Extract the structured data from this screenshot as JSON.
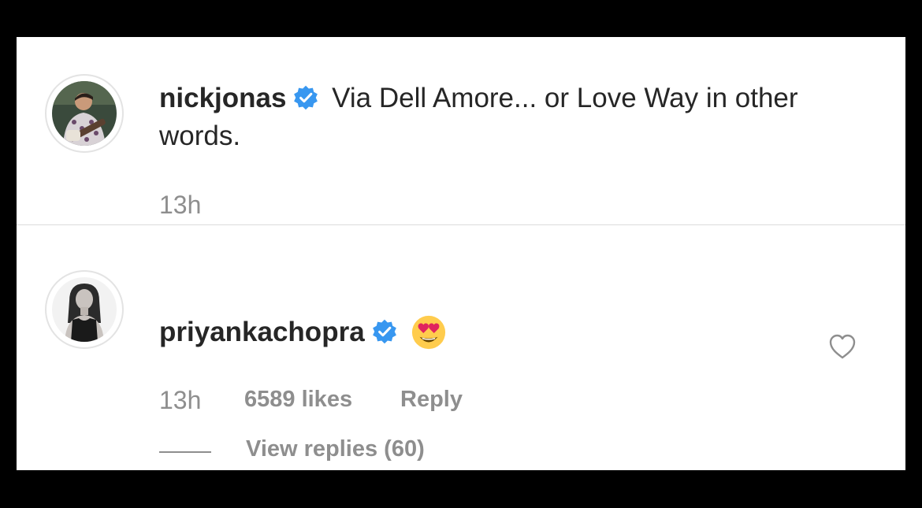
{
  "comments": [
    {
      "username": "nickjonas",
      "verified": true,
      "text": "Via Dell Amore... or Love Way in other words.",
      "time": "13h",
      "avatar": "guitarist-avatar"
    },
    {
      "username": "priyankachopra",
      "verified": true,
      "emoji": "heart-eyes-emoji",
      "time": "13h",
      "likes": "6589 likes",
      "reply_label": "Reply",
      "view_replies": "View replies (60)",
      "avatar": "portrait-avatar"
    }
  ],
  "colors": {
    "frame": "#000000",
    "card": "#ffffff",
    "text": "#262626",
    "muted": "#8e8e8e",
    "verified_blue": "#3897f0",
    "divider": "#dbdbdb"
  },
  "icons": [
    "verified-badge-icon",
    "heart-outline-icon",
    "heart-eyes-emoji"
  ]
}
